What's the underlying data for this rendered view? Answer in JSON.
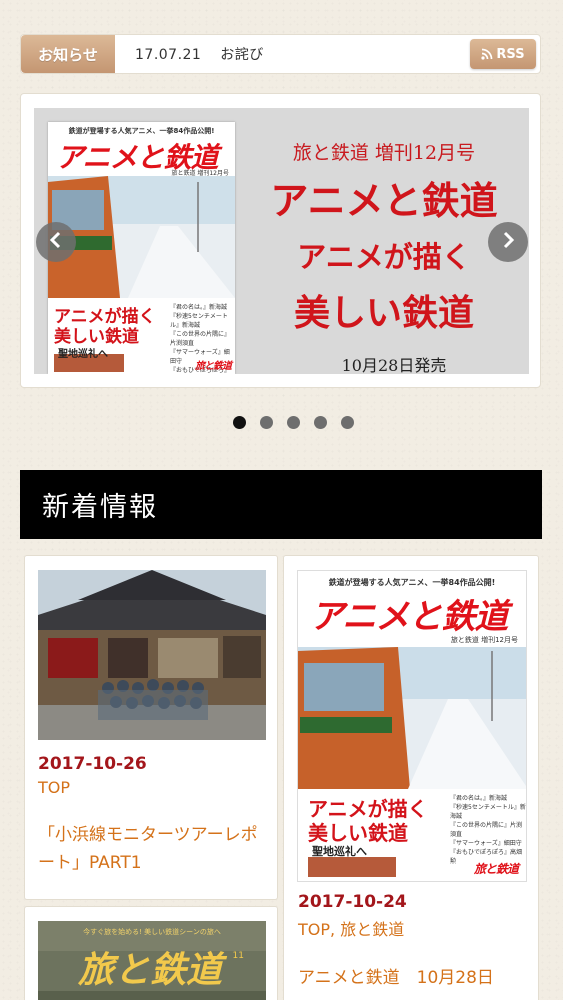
{
  "notice": {
    "label": "お知らせ",
    "date": "17.07.21",
    "text": "お詫び",
    "rss_label": "RSS"
  },
  "slider": {
    "cover": {
      "tagline": "鉄道が登場する人気アニメ、一挙84作品公開!",
      "logo": "アニメと鉄道",
      "logo_en": "Animes & Trains",
      "edition": "旅と鉄道 増刊12月号",
      "headline_a": "アニメが描く",
      "headline_b": "美しい鉄道",
      "pilgrimage": "聖地巡礼へ",
      "works": [
        "『君の名は。』新海誠",
        "『秒速5センチメートル』新海誠",
        "『この世界の片隅に』片渕須直",
        "『サマーウォーズ』細田守",
        "『おもひでぽろぽろ』高畑勲"
      ],
      "brand": "旅と鉄道"
    },
    "heading_sub": "旅と鉄道 増刊12月号",
    "heading_main": "アニメと鉄道",
    "heading_line2": "アニメが描く",
    "heading_line3": "美しい鉄道",
    "release": "10月28日発売",
    "prev_icon": "chevron-left-icon",
    "next_icon": "chevron-right-icon",
    "dot_count": 5,
    "active_dot": 0
  },
  "section": {
    "title": "新着情報"
  },
  "posts": [
    {
      "date": "2017-10-26",
      "categories": [
        "TOP"
      ],
      "title": "「小浜線モニターツアーレポート」PART1"
    },
    {
      "date": "2017-10-24",
      "categories": [
        "TOP",
        "旅と鉄道"
      ],
      "cat_sep": ", ",
      "title": "アニメと鉄道　10月28日"
    },
    {
      "cover_tagline": "今すぐ旅を始める! 美しい鉄道シーンの旅へ",
      "cover_logo": "旅と鉄道",
      "cover_issue": "11"
    }
  ],
  "colors": {
    "accent_date": "#a3161b",
    "link": "#d4721a",
    "tab": "#c49672"
  }
}
